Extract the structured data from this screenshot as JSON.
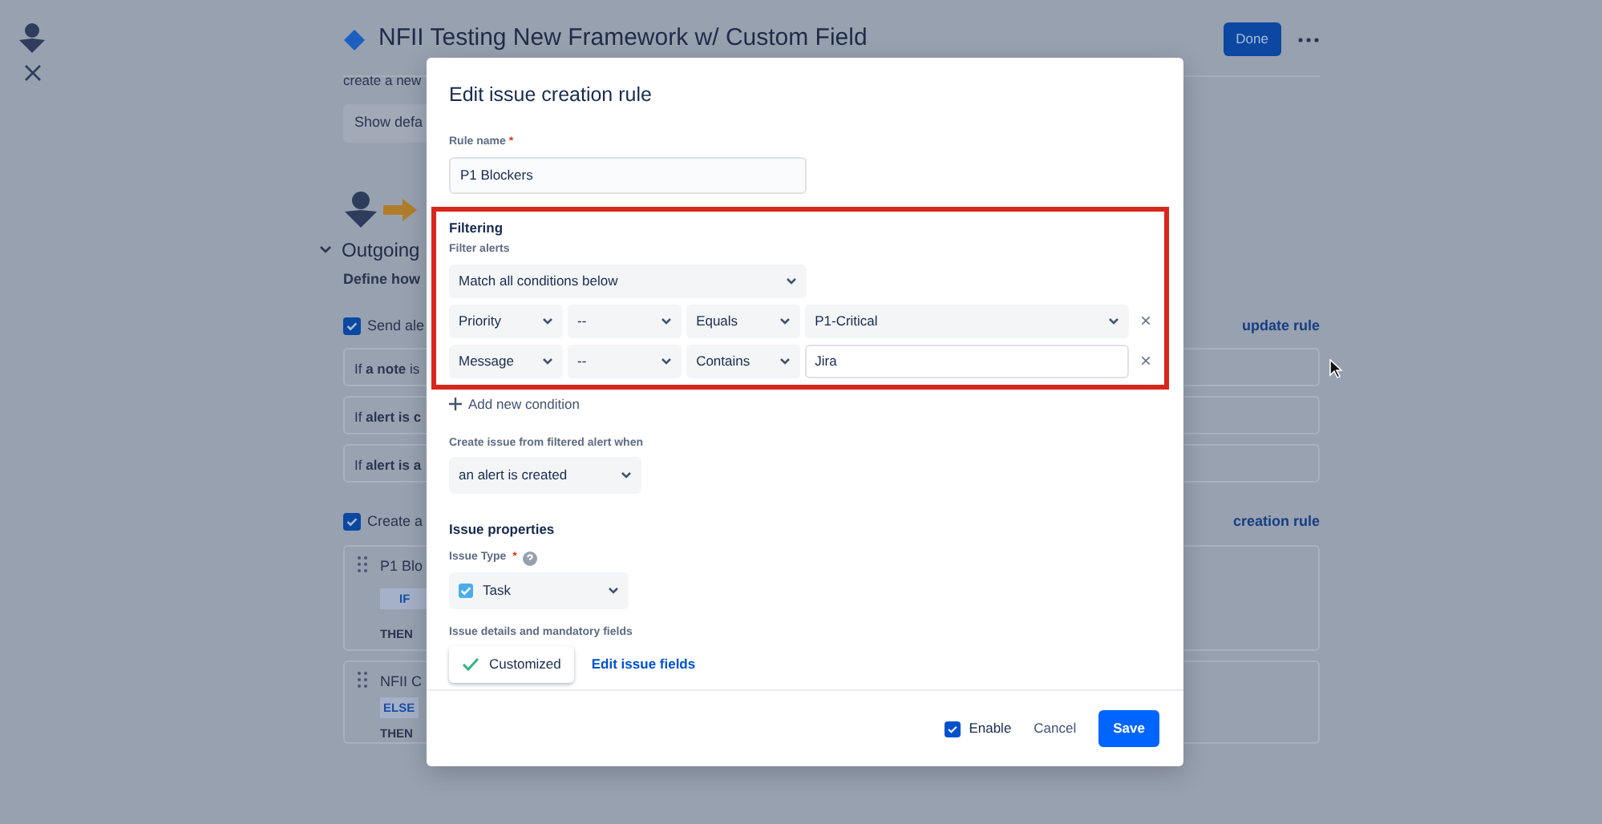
{
  "page": {
    "title": "NFII Testing New Framework w/ Custom Field",
    "done_button": "Done",
    "description": "create a new",
    "show_button": "Show defa",
    "section": {
      "title": "Outgoing",
      "expanded": true,
      "text": "Define how"
    },
    "send_option": {
      "label": "Send ale",
      "checked": true,
      "link": "update rule"
    },
    "note_rows": [
      "If **a note** is",
      "If **alert is c**",
      "If **alert is a**"
    ],
    "create_option": {
      "label": "Create a",
      "checked": true,
      "link": "creation rule"
    },
    "rules": [
      {
        "name": "P1 Blo",
        "badge": "IF",
        "then": "THEN"
      },
      {
        "name": "NFII C",
        "badge": "ELSE",
        "then": "THEN"
      }
    ]
  },
  "dialog": {
    "title": "Edit issue creation rule",
    "rule_name": {
      "label": "Rule name",
      "required_mark": "*",
      "value": "P1 Blockers"
    },
    "filtering": {
      "title": "Filtering",
      "label": "Filter alerts",
      "match": "Match all conditions below",
      "conditions": [
        {
          "field": "Priority",
          "sub": "--",
          "operator": "Equals",
          "value": "P1-Critical",
          "kind": "select",
          "remove": "×"
        },
        {
          "field": "Message",
          "sub": "--",
          "operator": "Contains",
          "value": "Jira",
          "kind": "text",
          "remove": "×"
        }
      ]
    },
    "add_condition": "Add new condition",
    "trigger": {
      "label": "Create issue from filtered alert when",
      "value": "an alert is created"
    },
    "issue_properties": {
      "title": "Issue properties",
      "type_label": "Issue Type",
      "required_mark": "*",
      "type_value": "Task",
      "details_label": "Issue details and mandatory fields",
      "customized": "Customized",
      "edit_link": "Edit issue fields"
    },
    "footer": {
      "enable": {
        "label": "Enable",
        "checked": true
      },
      "cancel": "Cancel",
      "save": "Save"
    }
  }
}
